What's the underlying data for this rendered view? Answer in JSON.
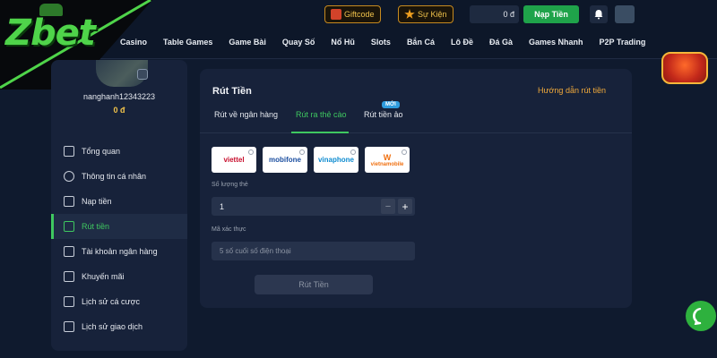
{
  "brand": {
    "logo_text": "Zbet"
  },
  "header": {
    "giftcode_label": "Giftcode",
    "event_label": "Sự Kiện",
    "balance": "0 đ",
    "deposit_label": "Nạp Tiền",
    "nav": [
      "Casino",
      "Table Games",
      "Game Bài",
      "Quay Số",
      "Nổ Hũ",
      "Slots",
      "Bắn Cá",
      "Lô Đề",
      "Đá Gà",
      "Games Nhanh",
      "P2P Trading"
    ]
  },
  "sidebar": {
    "username": "nanghanh12343223",
    "balance": "0 đ",
    "items": [
      {
        "label": "Tổng quan",
        "icon": "chart-icon"
      },
      {
        "label": "Thông tin cá nhân",
        "icon": "user-icon"
      },
      {
        "label": "Nạp tiền",
        "icon": "deposit-icon"
      },
      {
        "label": "Rút tiền",
        "icon": "withdraw-icon"
      },
      {
        "label": "Tài khoản ngân hàng",
        "icon": "bank-icon"
      },
      {
        "label": "Khuyến mãi",
        "icon": "gift-icon"
      },
      {
        "label": "Lịch sử cá cược",
        "icon": "history-icon"
      },
      {
        "label": "Lịch sử giao dịch",
        "icon": "document-icon"
      }
    ],
    "active_index": 3
  },
  "main": {
    "title": "Rút Tiền",
    "guide_link": "Hướng dẫn rút tiền",
    "tabs": [
      "Rút về ngân hàng",
      "Rút ra thẻ cào",
      "Rút tiền ảo"
    ],
    "active_tab": 1,
    "new_badge": "MỚI",
    "carriers": [
      "viettel",
      "mobifone",
      "vinaphone",
      "vietnamobile"
    ],
    "quantity_label": "Số lượng thẻ",
    "quantity_value": "1",
    "code_label": "Mã xác thực",
    "code_placeholder": "5 số cuối số điện thoại",
    "submit_label": "Rút Tiền"
  },
  "colors": {
    "accent": "#3fc860",
    "gold": "#f0c24b",
    "link": "#f0a93a",
    "background": "#0f1a2e",
    "panel": "#17223a"
  }
}
